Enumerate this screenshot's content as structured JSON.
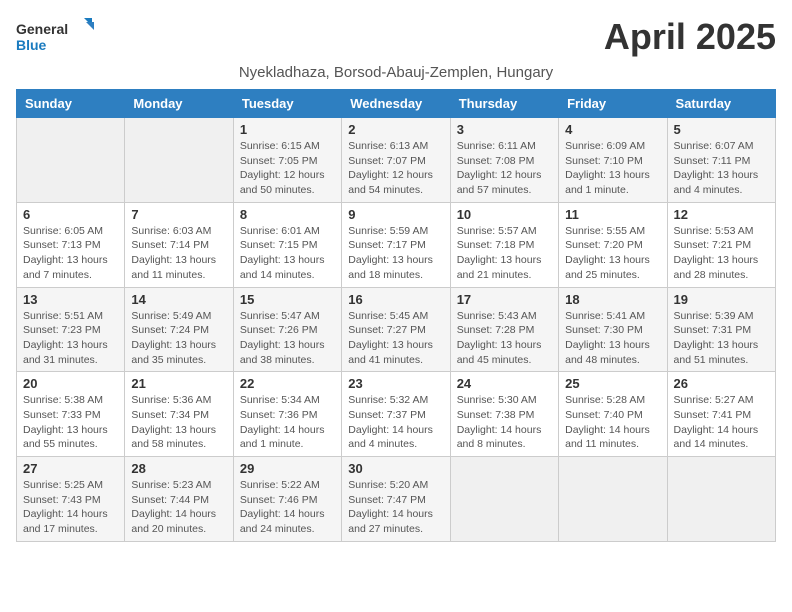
{
  "logo": {
    "line1": "General",
    "line2": "Blue"
  },
  "title": "April 2025",
  "subtitle": "Nyekladhaza, Borsod-Abauj-Zemplen, Hungary",
  "headers": [
    "Sunday",
    "Monday",
    "Tuesday",
    "Wednesday",
    "Thursday",
    "Friday",
    "Saturday"
  ],
  "weeks": [
    [
      {
        "day": "",
        "info": ""
      },
      {
        "day": "",
        "info": ""
      },
      {
        "day": "1",
        "info": "Sunrise: 6:15 AM\nSunset: 7:05 PM\nDaylight: 12 hours and 50 minutes."
      },
      {
        "day": "2",
        "info": "Sunrise: 6:13 AM\nSunset: 7:07 PM\nDaylight: 12 hours and 54 minutes."
      },
      {
        "day": "3",
        "info": "Sunrise: 6:11 AM\nSunset: 7:08 PM\nDaylight: 12 hours and 57 minutes."
      },
      {
        "day": "4",
        "info": "Sunrise: 6:09 AM\nSunset: 7:10 PM\nDaylight: 13 hours and 1 minute."
      },
      {
        "day": "5",
        "info": "Sunrise: 6:07 AM\nSunset: 7:11 PM\nDaylight: 13 hours and 4 minutes."
      }
    ],
    [
      {
        "day": "6",
        "info": "Sunrise: 6:05 AM\nSunset: 7:13 PM\nDaylight: 13 hours and 7 minutes."
      },
      {
        "day": "7",
        "info": "Sunrise: 6:03 AM\nSunset: 7:14 PM\nDaylight: 13 hours and 11 minutes."
      },
      {
        "day": "8",
        "info": "Sunrise: 6:01 AM\nSunset: 7:15 PM\nDaylight: 13 hours and 14 minutes."
      },
      {
        "day": "9",
        "info": "Sunrise: 5:59 AM\nSunset: 7:17 PM\nDaylight: 13 hours and 18 minutes."
      },
      {
        "day": "10",
        "info": "Sunrise: 5:57 AM\nSunset: 7:18 PM\nDaylight: 13 hours and 21 minutes."
      },
      {
        "day": "11",
        "info": "Sunrise: 5:55 AM\nSunset: 7:20 PM\nDaylight: 13 hours and 25 minutes."
      },
      {
        "day": "12",
        "info": "Sunrise: 5:53 AM\nSunset: 7:21 PM\nDaylight: 13 hours and 28 minutes."
      }
    ],
    [
      {
        "day": "13",
        "info": "Sunrise: 5:51 AM\nSunset: 7:23 PM\nDaylight: 13 hours and 31 minutes."
      },
      {
        "day": "14",
        "info": "Sunrise: 5:49 AM\nSunset: 7:24 PM\nDaylight: 13 hours and 35 minutes."
      },
      {
        "day": "15",
        "info": "Sunrise: 5:47 AM\nSunset: 7:26 PM\nDaylight: 13 hours and 38 minutes."
      },
      {
        "day": "16",
        "info": "Sunrise: 5:45 AM\nSunset: 7:27 PM\nDaylight: 13 hours and 41 minutes."
      },
      {
        "day": "17",
        "info": "Sunrise: 5:43 AM\nSunset: 7:28 PM\nDaylight: 13 hours and 45 minutes."
      },
      {
        "day": "18",
        "info": "Sunrise: 5:41 AM\nSunset: 7:30 PM\nDaylight: 13 hours and 48 minutes."
      },
      {
        "day": "19",
        "info": "Sunrise: 5:39 AM\nSunset: 7:31 PM\nDaylight: 13 hours and 51 minutes."
      }
    ],
    [
      {
        "day": "20",
        "info": "Sunrise: 5:38 AM\nSunset: 7:33 PM\nDaylight: 13 hours and 55 minutes."
      },
      {
        "day": "21",
        "info": "Sunrise: 5:36 AM\nSunset: 7:34 PM\nDaylight: 13 hours and 58 minutes."
      },
      {
        "day": "22",
        "info": "Sunrise: 5:34 AM\nSunset: 7:36 PM\nDaylight: 14 hours and 1 minute."
      },
      {
        "day": "23",
        "info": "Sunrise: 5:32 AM\nSunset: 7:37 PM\nDaylight: 14 hours and 4 minutes."
      },
      {
        "day": "24",
        "info": "Sunrise: 5:30 AM\nSunset: 7:38 PM\nDaylight: 14 hours and 8 minutes."
      },
      {
        "day": "25",
        "info": "Sunrise: 5:28 AM\nSunset: 7:40 PM\nDaylight: 14 hours and 11 minutes."
      },
      {
        "day": "26",
        "info": "Sunrise: 5:27 AM\nSunset: 7:41 PM\nDaylight: 14 hours and 14 minutes."
      }
    ],
    [
      {
        "day": "27",
        "info": "Sunrise: 5:25 AM\nSunset: 7:43 PM\nDaylight: 14 hours and 17 minutes."
      },
      {
        "day": "28",
        "info": "Sunrise: 5:23 AM\nSunset: 7:44 PM\nDaylight: 14 hours and 20 minutes."
      },
      {
        "day": "29",
        "info": "Sunrise: 5:22 AM\nSunset: 7:46 PM\nDaylight: 14 hours and 24 minutes."
      },
      {
        "day": "30",
        "info": "Sunrise: 5:20 AM\nSunset: 7:47 PM\nDaylight: 14 hours and 27 minutes."
      },
      {
        "day": "",
        "info": ""
      },
      {
        "day": "",
        "info": ""
      },
      {
        "day": "",
        "info": ""
      }
    ]
  ]
}
